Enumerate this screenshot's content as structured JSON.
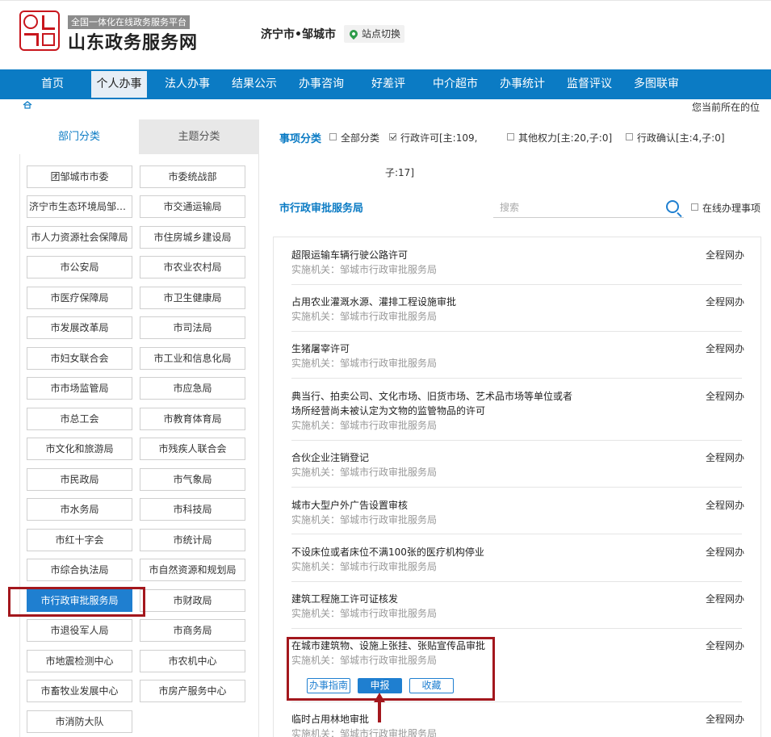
{
  "header": {
    "logo_sub": "全国一体化在线政务服务平台",
    "logo_main": "山东政务服务网",
    "location": "济宁市•邹城市",
    "site_switch": "站点切换"
  },
  "nav": [
    "首页",
    "个人办事",
    "法人办事",
    "结果公示",
    "办事咨询",
    "好差评",
    "中介超市",
    "办事统计",
    "监督评议",
    "多图联审"
  ],
  "nav_active": "个人办事",
  "breadcrumb": {
    "text": "您当前所在的位"
  },
  "left": {
    "tabs": [
      "部门分类",
      "主题分类"
    ],
    "departments": [
      "团邹城市市委",
      "市委统战部",
      "济宁市生态环境局邹城...",
      "市交通运输局",
      "市人力资源社会保障局",
      "市住房城乡建设局",
      "市公安局",
      "市农业农村局",
      "市医疗保障局",
      "市卫生健康局",
      "市发展改革局",
      "市司法局",
      "市妇女联合会",
      "市工业和信息化局",
      "市市场监管局",
      "市应急局",
      "市总工会",
      "市教育体育局",
      "市文化和旅游局",
      "市残疾人联合会",
      "市民政局",
      "市气象局",
      "市水务局",
      "市科技局",
      "市红十字会",
      "市统计局",
      "市综合执法局",
      "市自然资源和规划局",
      "市行政审批服务局",
      "市财政局",
      "市退役军人局",
      "市商务局",
      "市地震检测中心",
      "市农机中心",
      "市畜牧业发展中心",
      "市房产服务中心",
      "市消防大队"
    ],
    "selected": "市行政审批服务局"
  },
  "filters": {
    "label": "事项分类",
    "options": [
      {
        "label": "全部分类",
        "checked": false
      },
      {
        "label": "行政许可[主:109,",
        "label2": "子:17]",
        "checked": true
      },
      {
        "label": "其他权力[主:20,子:0]",
        "checked": false
      },
      {
        "label": "行政确认[主:4,子:0]",
        "checked": false
      }
    ]
  },
  "bureau": {
    "title": "市行政审批服务局"
  },
  "search": {
    "placeholder": "搜索",
    "online_label": "在线办理事项"
  },
  "items": [
    {
      "title": "超限运输车辆行驶公路许可",
      "agency": "实施机关：邹城市行政审批服务局",
      "mode": "全程网办"
    },
    {
      "title": "占用农业灌溉水源、灌排工程设施审批",
      "agency": "实施机关：邹城市行政审批服务局",
      "mode": "全程网办"
    },
    {
      "title": "生猪屠宰许可",
      "agency": "实施机关：邹城市行政审批服务局",
      "mode": "全程网办"
    },
    {
      "title": "典当行、拍卖公司、文化市场、旧货市场、艺术品市场等单位或者",
      "title2": "场所经营尚未被认定为文物的监管物品的许可",
      "agency": "实施机关：邹城市行政审批服务局",
      "mode": "全程网办"
    },
    {
      "title": "合伙企业注销登记",
      "agency": "实施机关：邹城市行政审批服务局",
      "mode": "全程网办"
    },
    {
      "title": "城市大型户外广告设置审核",
      "agency": "实施机关：邹城市行政审批服务局",
      "mode": "全程网办"
    },
    {
      "title": "不设床位或者床位不满100张的医疗机构停业",
      "agency": "实施机关：邹城市行政审批服务局",
      "mode": "全程网办"
    },
    {
      "title": "建筑工程施工许可证核发",
      "agency": "实施机关：邹城市行政审批服务局",
      "mode": "全程网办"
    },
    {
      "title": "在城市建筑物、设施上张挂、张贴宣传品审批",
      "agency": "实施机关：邹城市行政审批服务局",
      "mode": "全程网办"
    },
    {
      "title": "临时占用林地审批",
      "agency": "实施机关：邹城市行政审批服务局",
      "mode": "全程网办"
    }
  ],
  "actions": {
    "guide": "办事指南",
    "apply": "申报",
    "favorite": "收藏"
  },
  "colors": {
    "nav_blue": "#0b7bc4",
    "accent_blue": "#1f7fd0",
    "highlight_red": "#a3171d"
  }
}
